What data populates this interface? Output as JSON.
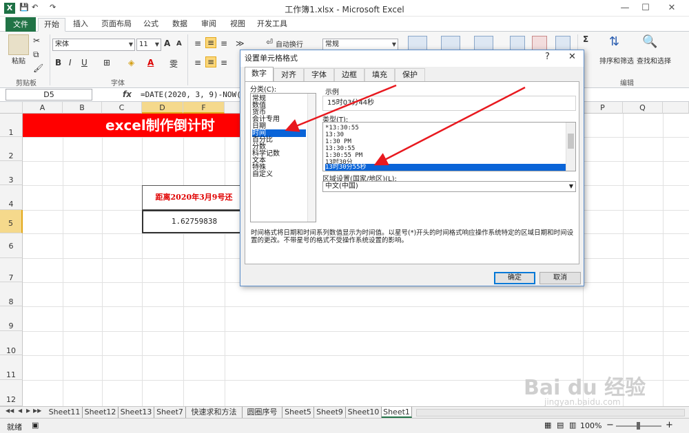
{
  "window": {
    "title": "工作簿1.xlsx - Microsoft Excel",
    "app_icon": "X",
    "min": "—",
    "max": "☐",
    "close": "✕"
  },
  "qat": {
    "save": "💾",
    "undo": "↶",
    "redo": "↷"
  },
  "tabs": [
    {
      "label": "文件"
    },
    {
      "label": "开始"
    },
    {
      "label": "插入"
    },
    {
      "label": "页面布局"
    },
    {
      "label": "公式"
    },
    {
      "label": "数据"
    },
    {
      "label": "审阅"
    },
    {
      "label": "视图"
    },
    {
      "label": "开发工具"
    }
  ],
  "ribbon": {
    "paste_label": "粘贴",
    "clipboard_group": "剪贴板",
    "font_group": "字体",
    "font_name": "宋体",
    "font_size": "11",
    "bold": "B",
    "italic": "I",
    "underline": "U",
    "wrap_text": "自动换行",
    "number_format": "常规",
    "sort_filter": "排序和筛选",
    "find_select": "查找和选择",
    "editing_group": "编辑",
    "grow_font": "A",
    "shrink_font": "A",
    "sigma": "Σ",
    "font_color": "A",
    "phonetic": "雯"
  },
  "formula_bar": {
    "name_box": "D5",
    "fx": "fx",
    "formula": "=DATE(2020, 3, 9)-NOW()"
  },
  "columns": [
    "A",
    "B",
    "C",
    "D",
    "F",
    "P",
    "Q"
  ],
  "rows": [
    "1",
    "2",
    "3",
    "4",
    "5",
    "6",
    "7",
    "8",
    "9",
    "10",
    "11",
    "12"
  ],
  "cells": {
    "banner": "excel制作倒计时",
    "box_title": "距离2020年3月9号还",
    "box_value": "1.62759838"
  },
  "sheets": [
    "Sheet11",
    "Sheet12",
    "Sheet13",
    "Sheet7",
    "快速求和方法",
    "圆圈序号",
    "Sheet5",
    "Sheet9",
    "Sheet10",
    "Sheet1"
  ],
  "status": {
    "ready": "就绪",
    "zoom": "100%",
    "zoom_minus": "−",
    "zoom_plus": "+"
  },
  "dialog": {
    "title": "设置单元格格式",
    "help": "?",
    "close": "✕",
    "tabs": [
      "数字",
      "对齐",
      "字体",
      "边框",
      "填充",
      "保护"
    ],
    "category_label": "分类(C):",
    "categories": [
      "常规",
      "数值",
      "货币",
      "会计专用",
      "日期",
      "时间",
      "百分比",
      "分数",
      "科学记数",
      "文本",
      "特殊",
      "自定义"
    ],
    "selected_category": "时间",
    "sample_label": "示例",
    "sample_value": "15时03分44秒",
    "type_label": "类型(T):",
    "types": [
      "*13:30:55",
      "13:30",
      "1:30 PM",
      "13:30:55",
      "1:30:55 PM",
      "13时30分",
      "13时30分55秒"
    ],
    "selected_type": "13时30分55秒",
    "locale_label": "区域设置(国家/地区)(L):",
    "locale_value": "中文(中国)",
    "description": "时间格式将日期和时间系列数值显示为时间值。以星号(*)开头的时间格式响应操作系统特定的区域日期和时间设置的更改。不带星号的格式不受操作系统设置的影响。",
    "ok": "确定",
    "cancel": "取消"
  },
  "watermark": {
    "brand": "Bai du 经验",
    "url": "jingyan.baidu.com"
  },
  "colors": {
    "excel_green": "#217346",
    "banner_red": "#ff0000",
    "selection_blue": "#0a64d8",
    "arrow_red": "#e8191f"
  }
}
